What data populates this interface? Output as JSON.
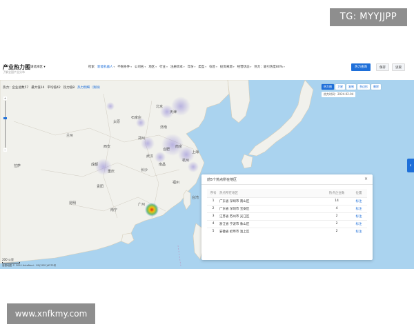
{
  "watermarks": {
    "top": "TG: MYYJJPP",
    "bottom": "www.xnfkmy.com"
  },
  "header": {
    "title": "产业热力图",
    "subtitle": "了解全国产业分布",
    "region_select": "请选择区",
    "filters": [
      {
        "label": "检索",
        "active": false
      },
      {
        "label": "新能机器人",
        "active": true
      },
      {
        "label": "不限条件",
        "active": false
      },
      {
        "label": "公司名",
        "active": false
      },
      {
        "label": "地区",
        "active": false
      },
      {
        "label": "行业",
        "active": false
      },
      {
        "label": "注册资本",
        "active": false
      },
      {
        "label": "年份",
        "active": false
      },
      {
        "label": "类型",
        "active": false
      },
      {
        "label": "标签",
        "active": false
      },
      {
        "label": "投资来源",
        "active": false
      },
      {
        "label": "经营状态",
        "active": false
      },
      {
        "label": "热力：吸引热度80%",
        "active": false
      }
    ],
    "buttons": {
      "primary": "热力查询",
      "save": "保存",
      "load": "读取"
    }
  },
  "stats": {
    "parts": [
      "热力：企业总数57",
      "最大值14",
      "平均值42",
      "热力值8"
    ],
    "link": "热力明细（清除）"
  },
  "map": {
    "tools": [
      {
        "label": "热力图",
        "primary": true
      },
      {
        "label": "卫星",
        "primary": false
      },
      {
        "label": "复制",
        "primary": false
      },
      {
        "label": "多边形",
        "primary": false
      },
      {
        "label": "删除",
        "primary": false
      }
    ],
    "time": "热力时间：2024-02-04",
    "scale": "200 公里",
    "copyright": "高德地图 © 2024 AutoNavi - GS(2021)6375号",
    "cities": [
      "北京",
      "天津",
      "石家庄",
      "太原",
      "济南",
      "郑州",
      "西安",
      "兰州",
      "成都",
      "重庆",
      "武汉",
      "长沙",
      "南京",
      "上海",
      "杭州",
      "合肥",
      "南昌",
      "福州",
      "广州",
      "南宁",
      "昆明",
      "贵阳",
      "拉萨",
      "台湾"
    ],
    "side_tab": "‹"
  },
  "popup": {
    "title": "前5个热点所在地区",
    "close": "×",
    "columns": [
      "序号",
      "热点所在地区",
      "热点企业数",
      "位置"
    ],
    "rows": [
      {
        "idx": "1",
        "region": "广东省 深圳市 南山区",
        "count": "14",
        "loc": "标注"
      },
      {
        "idx": "2",
        "region": "广东省 深圳市 宝安区",
        "count": "4",
        "loc": "标注"
      },
      {
        "idx": "3",
        "region": "江苏省 苏州市 吴江区",
        "count": "2",
        "loc": "标注"
      },
      {
        "idx": "4",
        "region": "浙江省 宁波市 象山区",
        "count": "2",
        "loc": "标注"
      },
      {
        "idx": "5",
        "region": "安徽省 蚌埠市 淮上区",
        "count": "2",
        "loc": "标注"
      }
    ]
  },
  "colors": {
    "accent": "#1e6fd9",
    "sea": "#aad3ef",
    "land": "#f1f1ec"
  }
}
